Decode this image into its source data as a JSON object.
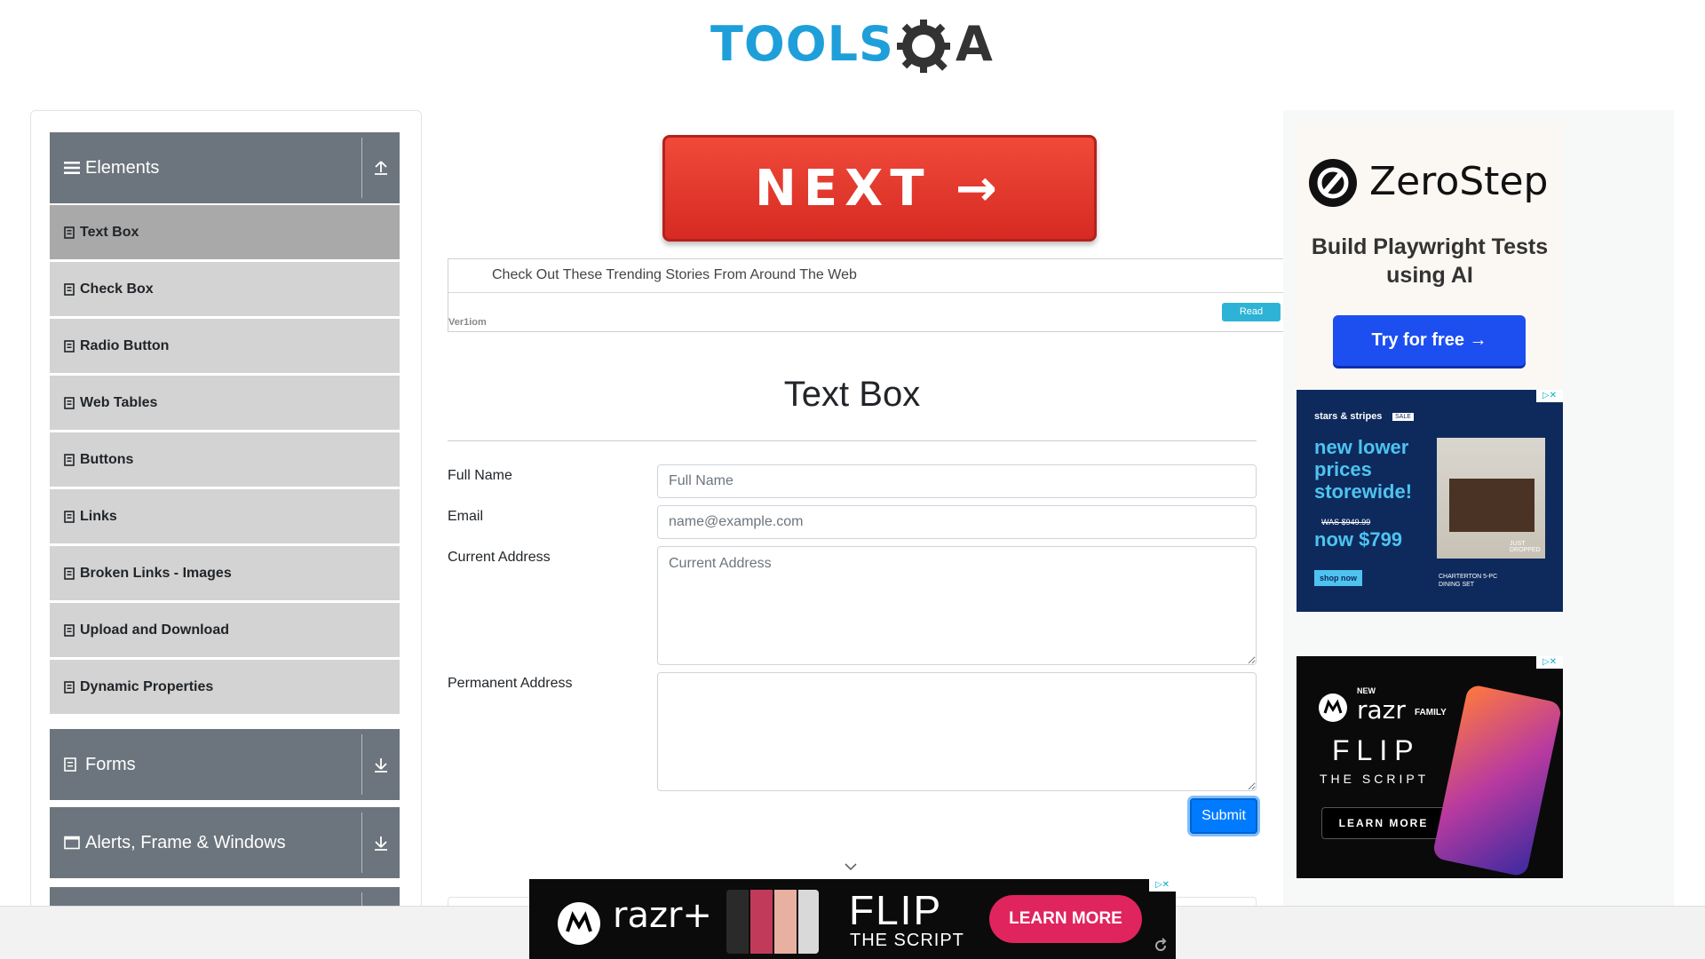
{
  "header": {
    "logo_text": "TOOLS",
    "logo_suffix": "A",
    "logo_gear_letter": "Q"
  },
  "sidebar": {
    "groups": [
      {
        "title": "Elements",
        "expanded": true,
        "icon": "hamburger-icon",
        "toggle_icon": "arrow-up-icon"
      },
      {
        "title": "Forms",
        "expanded": false,
        "icon": "document-icon",
        "toggle_icon": "arrow-down-icon"
      },
      {
        "title": "Alerts, Frame & Windows",
        "expanded": false,
        "icon": "window-icon",
        "toggle_icon": "arrow-down-icon"
      }
    ],
    "items": [
      {
        "label": "Text Box",
        "active": true
      },
      {
        "label": "Check Box",
        "active": false
      },
      {
        "label": "Radio Button",
        "active": false
      },
      {
        "label": "Web Tables",
        "active": false
      },
      {
        "label": "Buttons",
        "active": false
      },
      {
        "label": "Links",
        "active": false
      },
      {
        "label": "Broken Links - Images",
        "active": false
      },
      {
        "label": "Upload and Download",
        "active": false
      },
      {
        "label": "Dynamic Properties",
        "active": false
      }
    ]
  },
  "banner": {
    "label": "NEXT →"
  },
  "trending": {
    "text": "Check Out These Trending Stories From Around The Web",
    "read_label": "Read",
    "brand": "Ver1iom"
  },
  "main": {
    "title": "Text Box",
    "form": {
      "full_name_label": "Full Name",
      "full_name_placeholder": "Full Name",
      "full_name_value": "",
      "email_label": "Email",
      "email_placeholder": "name@example.com",
      "email_value": "",
      "current_address_label": "Current Address",
      "current_address_placeholder": "Current Address",
      "current_address_value": "",
      "permanent_address_label": "Permanent Address",
      "permanent_address_placeholder": "",
      "permanent_address_value": "",
      "submit_label": "Submit"
    }
  },
  "ads": {
    "zerostep": {
      "brand": "ZeroStep",
      "tagline": "Build Playwright Tests using AI",
      "cta": "Try for free →"
    },
    "stars": {
      "brand": "stars & stripes",
      "badge": "SALE",
      "headline": "new lower prices storewide!",
      "was": "WAS $949.99",
      "now": "now $799",
      "cta": "shop now",
      "caption": "CHARTERTON 5-PC DINING SET",
      "flag": "JUST DROPPED"
    },
    "razr_side": {
      "new": "NEW",
      "brand": "razr",
      "family": "FAMILY",
      "headline": "FLIP",
      "subhead": "THE SCRIPT",
      "cta": "LEARN MORE"
    },
    "razr_bottom": {
      "brand": "razr+",
      "headline": "FLIP",
      "subhead": "THE SCRIPT",
      "cta": "LEARN MORE"
    }
  },
  "colors": {
    "sidebar_header": "#6c757d",
    "menu_item": "#d3d3d3",
    "menu_item_active": "#a9a9a9",
    "submit": "#007bff",
    "next_banner": "#e0362c",
    "logo_blue": "#1E9FD9"
  }
}
